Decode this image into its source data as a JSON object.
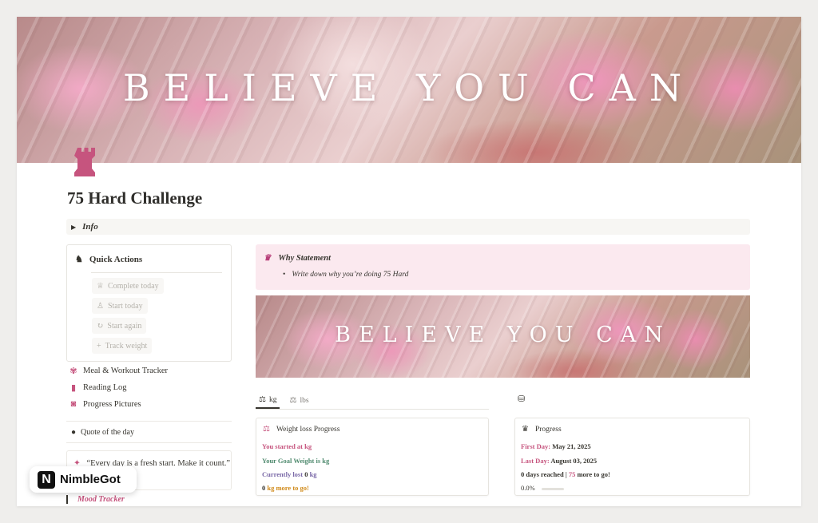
{
  "banner": {
    "text": "BELIEVE YOU CAN"
  },
  "page": {
    "title": "75 Hard Challenge",
    "icon": "rook-chess-icon"
  },
  "info": {
    "label": "Info"
  },
  "quick_actions": {
    "title": "Quick Actions",
    "buttons": [
      {
        "label": "Complete today",
        "icon": "crown-icon"
      },
      {
        "label": "Start today",
        "icon": "pawn-icon"
      },
      {
        "label": "Start again",
        "icon": "refresh-icon"
      },
      {
        "label": "Track weight",
        "icon": "plus-icon"
      }
    ]
  },
  "links": [
    {
      "label": "Meal & Workout Tracker",
      "icon": "gear-flower-icon"
    },
    {
      "label": "Reading Log",
      "icon": "book-icon"
    },
    {
      "label": "Progress Pictures",
      "icon": "camera-icon"
    }
  ],
  "quote": {
    "heading": "Quote of the day",
    "text": "“Every day is a fresh start. Make it count.”"
  },
  "mood": {
    "label": "Mood Tracker"
  },
  "why": {
    "title": "Why Statement",
    "item": "Write down why you’re doing 75 Hard"
  },
  "banner2": {
    "text": "BELIEVE YOU CAN"
  },
  "tabs": [
    {
      "label": "kg",
      "icon": "scale-icon"
    },
    {
      "label": "lbs",
      "icon": "scale-icon"
    }
  ],
  "weight_card": {
    "title": "Weight loss Progress",
    "started_label": "You started at",
    "started_unit": "kg",
    "goal_label": "Your Goal Weight is",
    "goal_unit": "kg",
    "lost_label": "Currently lost",
    "lost_value": "0",
    "lost_unit": "kg",
    "more_value": "0",
    "more_label": "kg more to go!"
  },
  "progress_card": {
    "title": "Progress",
    "first_label": "First Day:",
    "first_value": "May 21, 2025",
    "last_label": "Last Day:",
    "last_value": "August 03, 2025",
    "reached_value": "0",
    "reached_label": "days reached",
    "sep": "|",
    "more_value": "75",
    "more_label": "more to go!",
    "percent_text": "0.0%",
    "percent": 0
  },
  "badge": {
    "logo": "N",
    "text": "NimbleGot"
  },
  "colors": {
    "accent": "#c6547e",
    "why_bg": "#fbe9ef"
  }
}
